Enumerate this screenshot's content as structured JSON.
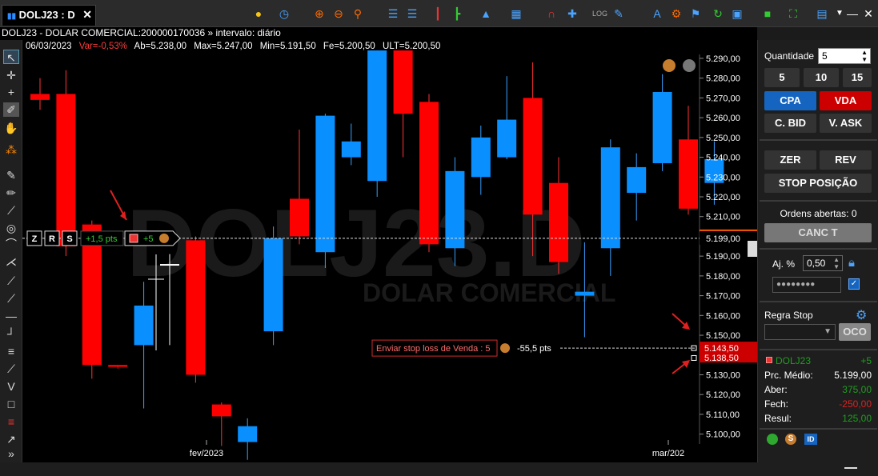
{
  "tab": {
    "label": "DOLJ23 : D"
  },
  "info": {
    "title": "DOLJ23 - DOLAR COMERCIAL:200000170036 » intervalo: diário"
  },
  "stats": {
    "date": "06/03/2023",
    "var": "Var=-0,53%",
    "ab": "Ab=5.238,00",
    "max": "Max=5.247,00",
    "min": "Min=5.191,50",
    "fe": "Fe=5.200,50",
    "ult": "ULT=5.200,50"
  },
  "watermark": {
    "symbol": "DOLJ23.D",
    "name": "DOLAR COMERCIAL"
  },
  "chart_data": {
    "type": "candlestick",
    "ylim": [
      5095,
      5292
    ],
    "price_labels": [
      "5.290,00",
      "5.280,00",
      "5.270,00",
      "5.260,00",
      "5.250,00",
      "5.240,00",
      "5.230,00",
      "5.220,00",
      "5.210,00",
      "5.190,00",
      "5.180,00",
      "5.170,00",
      "5.160,00",
      "5.150,00",
      "5.130,00",
      "5.120,00",
      "5.110,00",
      "5.100,00"
    ],
    "x_labels": [
      "fev/2023",
      "mar/202"
    ],
    "candles": [
      {
        "o": 5272,
        "c": 5269,
        "h": 5280,
        "l": 5264,
        "d": "down"
      },
      {
        "o": 5272,
        "c": 5195,
        "h": 5284,
        "l": 5190,
        "d": "down"
      },
      {
        "o": 5206,
        "c": 5135,
        "h": 5208,
        "l": 5128,
        "d": "down"
      },
      {
        "o": 5135,
        "c": 5134,
        "h": 5135,
        "l": 5133,
        "d": "flat"
      },
      {
        "o": 5145,
        "c": 5165,
        "h": 5177,
        "l": 5113,
        "d": "up"
      },
      {
        "o": 5186,
        "c": 5186,
        "h": 5191,
        "l": 5145,
        "d": "flat"
      },
      {
        "o": 5198,
        "c": 5130,
        "h": 5200,
        "l": 5126,
        "d": "down"
      },
      {
        "o": 5115,
        "c": 5109,
        "h": 5116,
        "l": 5094,
        "d": "down"
      },
      {
        "o": 5096,
        "c": 5104,
        "h": 5108,
        "l": 5087,
        "d": "up"
      },
      {
        "o": 5152,
        "c": 5199,
        "h": 5205,
        "l": 5145,
        "d": "up"
      },
      {
        "o": 5219,
        "c": 5200,
        "h": 5254,
        "l": 5196,
        "d": "down"
      },
      {
        "o": 5192,
        "c": 5261,
        "h": 5262,
        "l": 5184,
        "d": "up"
      },
      {
        "o": 5240,
        "c": 5248,
        "h": 5257,
        "l": 5236,
        "d": "up"
      },
      {
        "o": 5228,
        "c": 5294,
        "h": 5294,
        "l": 5220,
        "d": "up"
      },
      {
        "o": 5294,
        "c": 5262,
        "h": 5294,
        "l": 5240,
        "d": "down"
      },
      {
        "o": 5268,
        "c": 5196,
        "h": 5272,
        "l": 5192,
        "d": "down"
      },
      {
        "o": 5194,
        "c": 5233,
        "h": 5240,
        "l": 5185,
        "d": "up"
      },
      {
        "o": 5230,
        "c": 5250,
        "h": 5256,
        "l": 5221,
        "d": "up"
      },
      {
        "o": 5240,
        "c": 5259,
        "h": 5281,
        "l": 5239,
        "d": "up"
      },
      {
        "o": 5270,
        "c": 5211,
        "h": 5288,
        "l": 5190,
        "d": "down"
      },
      {
        "o": 5227,
        "c": 5187,
        "h": 5240,
        "l": 5181,
        "d": "down"
      },
      {
        "o": 5172,
        "c": 5170,
        "h": 5197,
        "l": 5149,
        "d": "up"
      },
      {
        "o": 5194,
        "c": 5245,
        "h": 5249,
        "l": 5180,
        "d": "up"
      },
      {
        "o": 5222,
        "c": 5235,
        "h": 5242,
        "l": 5208,
        "d": "up"
      },
      {
        "o": 5237,
        "c": 5273,
        "h": 5282,
        "l": 5233,
        "d": "up"
      },
      {
        "o": 5249,
        "c": 5214,
        "h": 5266,
        "l": 5211,
        "d": "down"
      },
      {
        "o": 5227,
        "c": 5239,
        "h": 5248,
        "l": 5216,
        "d": "up"
      }
    ],
    "position_line": {
      "price": 5199.0,
      "label": "5.199,00",
      "points": "+1,5 pts",
      "qty": "+5",
      "buttons": [
        "Z",
        "R",
        "S"
      ]
    },
    "stop_line": {
      "price": 5143.5,
      "price2": 5138.5,
      "label": "5.143,50",
      "label2": "5.138,50",
      "order_text": "Enviar stop loss de Venda : 5",
      "pts": "-55,5 pts"
    }
  },
  "panel": {
    "qty_label": "Quantidade",
    "qty_value": "5",
    "qty_buttons": [
      "5",
      "10",
      "15"
    ],
    "cpa": "CPA",
    "vda": "VDA",
    "cbid": "C. BID",
    "vask": "V. ASK",
    "zer": "ZER",
    "rev": "REV",
    "stop_pos": "STOP POSIÇÃO",
    "ordens": "Ordens abertas: 0",
    "canc": "CANC T",
    "aj_label": "Aj. %",
    "aj_value": "0,50",
    "password": "●●●●●●●●",
    "regra_stop": "Regra Stop",
    "oco": "OCO",
    "symbol": "DOLJ23",
    "symbol_qty": "+5",
    "preco_label": "Prc. Médio:",
    "preco_value": "5.199,00",
    "aber_label": "Aber:",
    "aber_value": "375,00",
    "fech_label": "Fech:",
    "fech_value": "-250,00",
    "resul_label": "Resul:",
    "resul_value": "125,00"
  },
  "colors": {
    "up": "#0a8fff",
    "down": "#ff0000",
    "bg": "#000000",
    "cpa": "#1565c0",
    "vda": "#cc0000",
    "gain": "#1f9e1f",
    "loss": "#e02020"
  }
}
